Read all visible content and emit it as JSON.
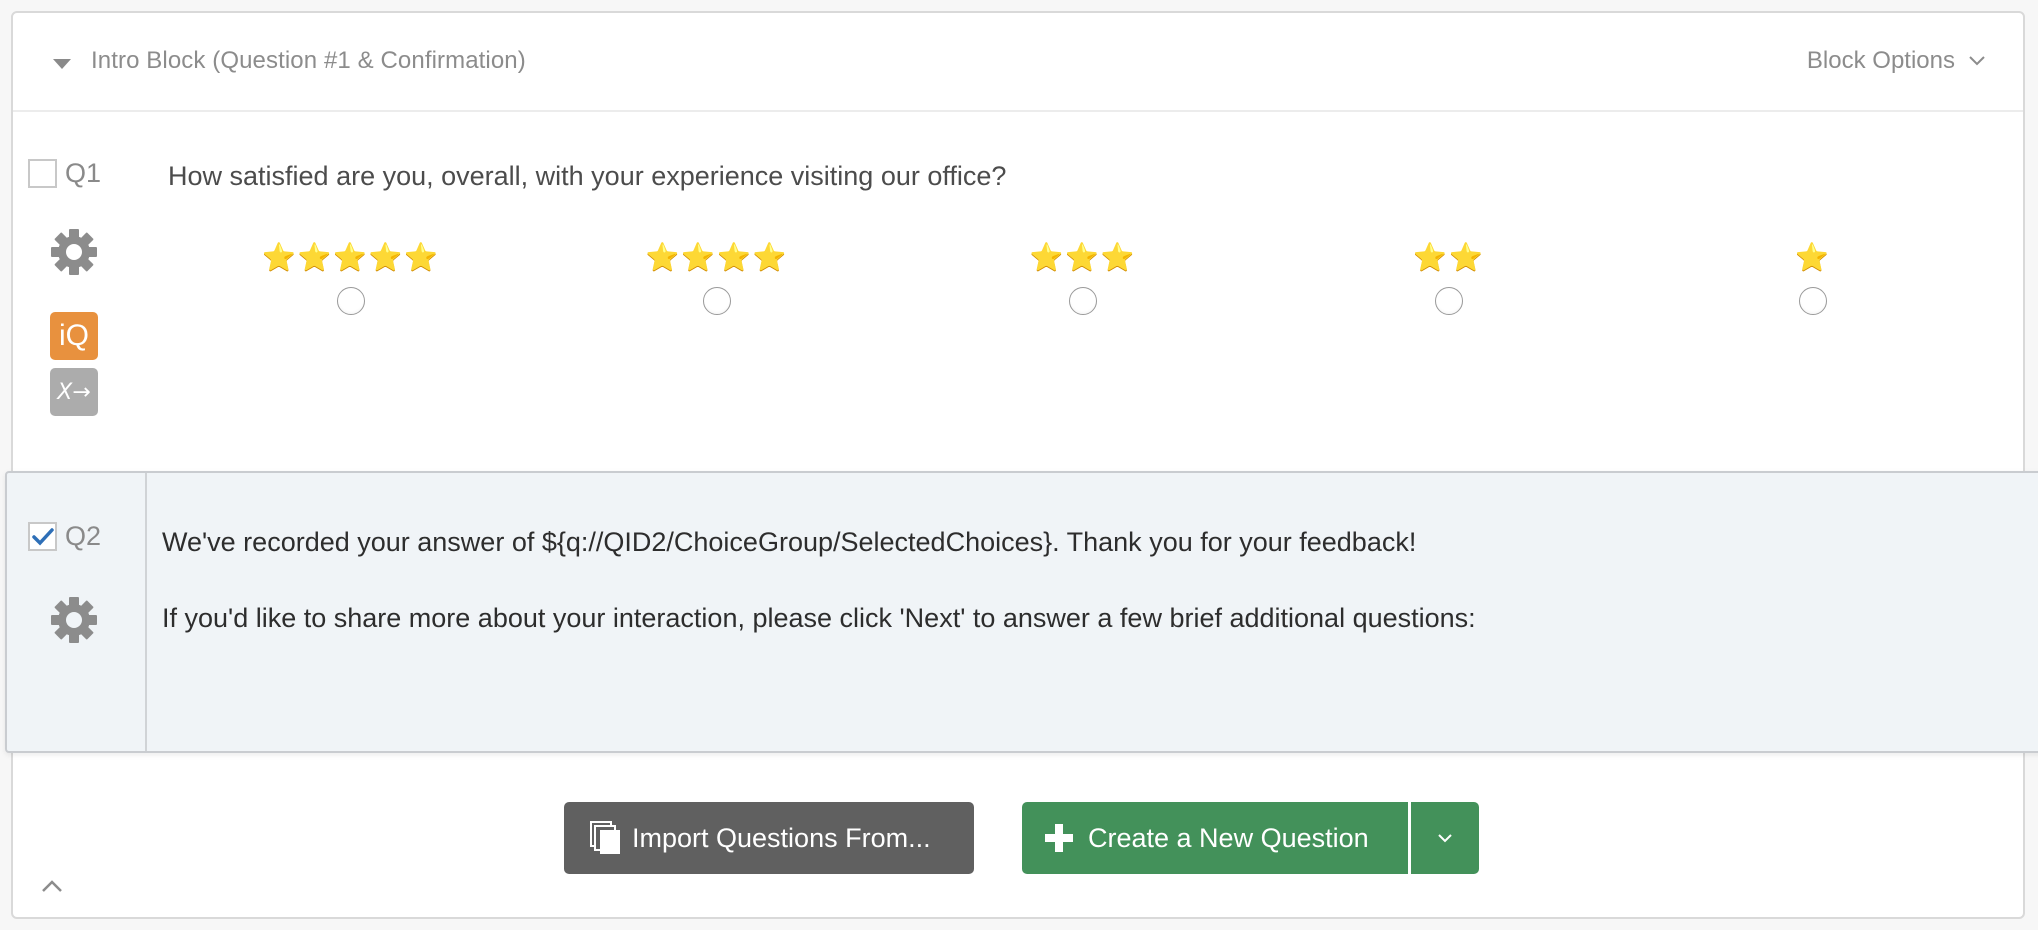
{
  "block": {
    "title": "Intro Block (Question #1 & Confirmation)",
    "options_label": "Block Options"
  },
  "q1": {
    "number": "Q1",
    "checked": false,
    "text": "How satisfied are you, overall, with your experience visiting our office?",
    "choices": [
      {
        "stars": 5,
        "label": "⭐⭐⭐⭐⭐",
        "selected": false
      },
      {
        "stars": 4,
        "label": "⭐⭐⭐⭐",
        "selected": false
      },
      {
        "stars": 3,
        "label": "⭐⭐⭐",
        "selected": false
      },
      {
        "stars": 2,
        "label": "⭐⭐",
        "selected": false
      },
      {
        "stars": 1,
        "label": "⭐",
        "selected": false
      }
    ],
    "badges": {
      "iq": "iQ",
      "piped": "X→"
    }
  },
  "q2": {
    "number": "Q2",
    "checked": true,
    "line1": "We've recorded your answer of ${q://QID2/ChoiceGroup/SelectedChoices}. Thank you for your feedback!",
    "line2": "If you'd like to share more about your interaction, please click 'Next' to answer a few brief additional questions:"
  },
  "actions": {
    "import_label": "Import Questions From...",
    "create_label": "Create a New Question"
  },
  "colors": {
    "create_green": "#43915a",
    "import_gray": "#606060",
    "iq_orange": "#e8913e",
    "selected_bg": "#f0f4f7",
    "check_blue": "#2e6fb7"
  }
}
